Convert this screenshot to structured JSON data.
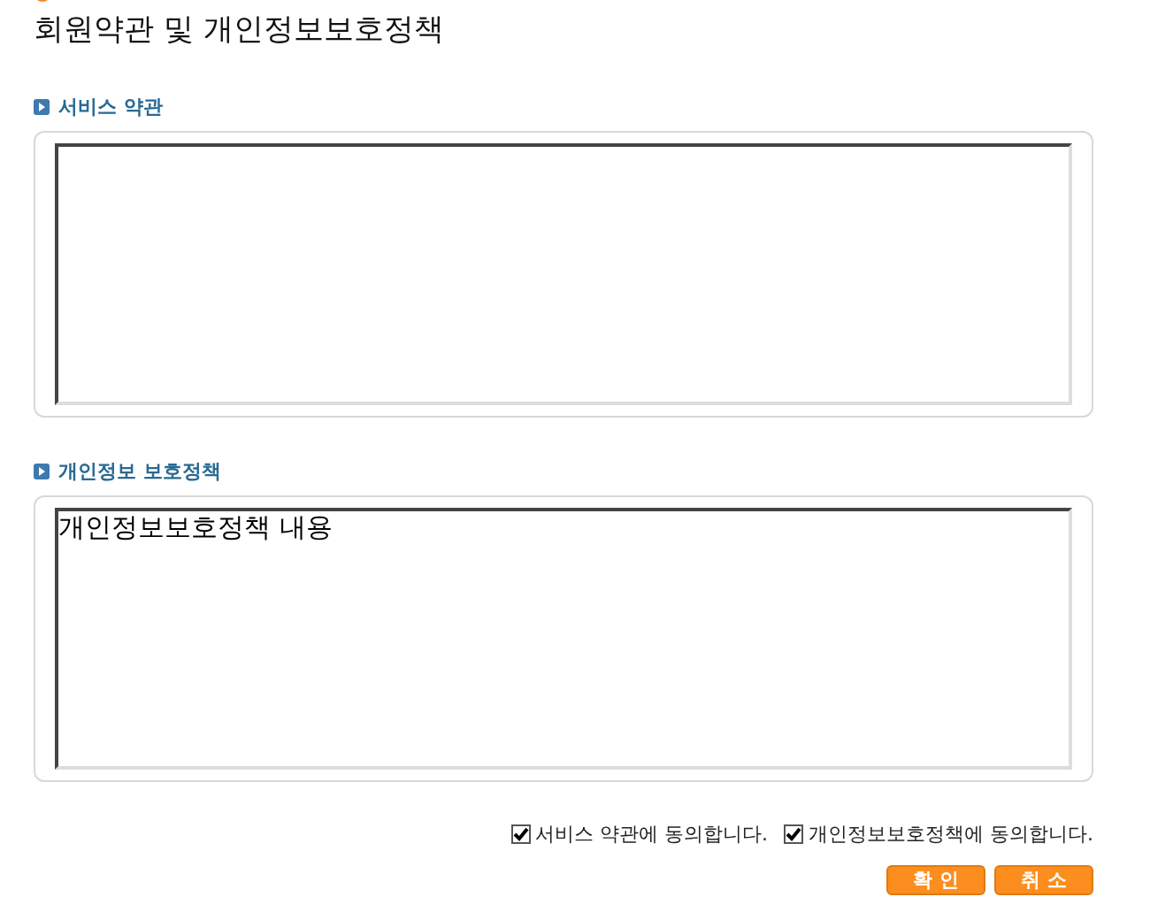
{
  "title": "회원약관 및 개인정보보호정책",
  "sections": [
    {
      "label": "서비스 약관"
    },
    {
      "label": "개인정보 보호정책",
      "content": "개인정보보호정책 내용"
    }
  ],
  "agreements": [
    {
      "label": "서비스 약관에 동의합니다.",
      "checked": true
    },
    {
      "label": "개인정보보호정책에 동의합니다.",
      "checked": true
    }
  ],
  "buttons": [
    "확 인",
    "취 소"
  ]
}
